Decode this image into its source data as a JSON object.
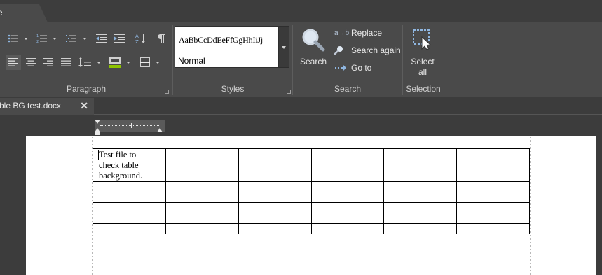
{
  "app": {
    "file_tab_label": "e",
    "theme_colors": {
      "background": "#3c3c3c",
      "ribbon": "#4a4a4a",
      "highlight_green": "#8ec400"
    }
  },
  "ribbon": {
    "groups": [
      {
        "label": "Paragraph"
      },
      {
        "label": "Styles"
      },
      {
        "label": "Search"
      },
      {
        "label": "Selection"
      }
    ],
    "paragraph": {
      "icons": [
        "bulleted-list-icon",
        "numbered-list-icon",
        "multilevel-list-icon",
        "decrease-indent-icon",
        "increase-indent-icon",
        "sort-icon",
        "pilcrow-icon",
        "align-left-icon",
        "align-center-icon",
        "align-right-icon",
        "justify-icon",
        "line-spacing-icon",
        "shading-icon",
        "borders-icon"
      ],
      "active_alignment": "left"
    },
    "styles": {
      "preview_text": "AaBbCcDdEeFfGgHhIiJj",
      "current_style": "Normal"
    },
    "search": {
      "search_label": "Search",
      "replace_label": "Replace",
      "search_again_label": "Search again",
      "goto_label": "Go to",
      "replace_icon_text": "a→b"
    },
    "selection": {
      "select_all_line1": "Select",
      "select_all_line2": "all"
    }
  },
  "document_tab": {
    "name": "ble BG test.docx",
    "close_glyph": "✕"
  },
  "document": {
    "table": {
      "rows": 6,
      "columns": 6,
      "first_cell_lines": [
        "Test file to",
        "check table",
        "background."
      ]
    }
  }
}
